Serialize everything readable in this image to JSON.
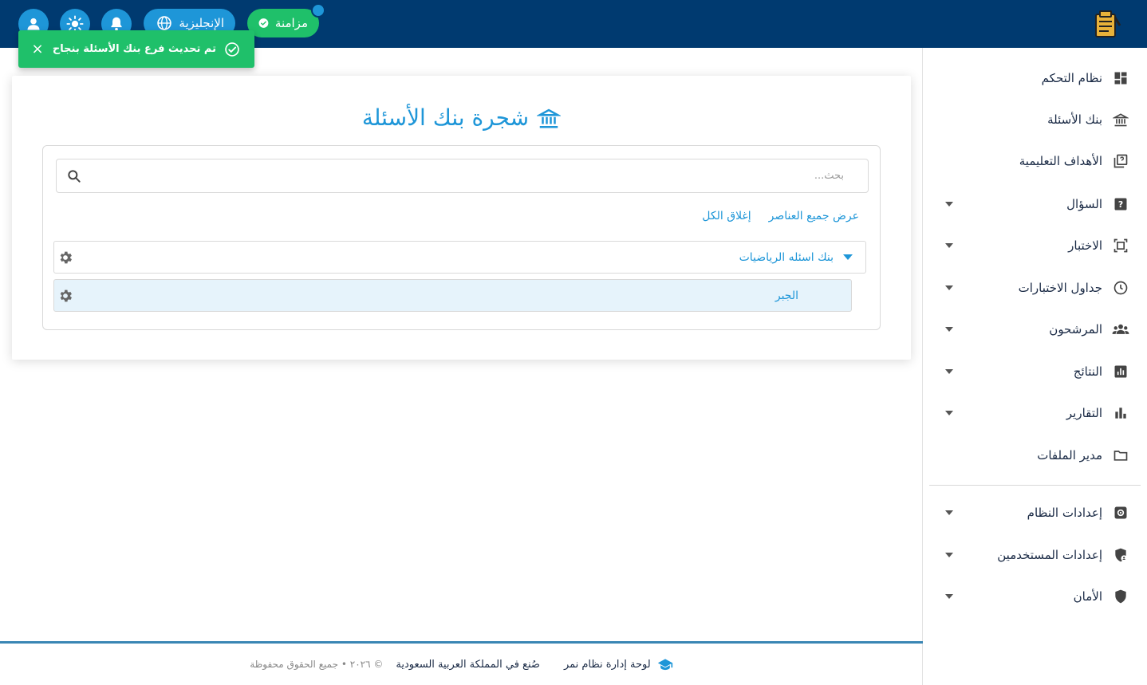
{
  "topbar": {
    "sync_label": "مزامنة",
    "language_label": "الإنجليزية",
    "icons": [
      "user-icon",
      "sun-icon",
      "bell-icon",
      "globe-icon",
      "check-circle-icon"
    ],
    "colors": {
      "bar": "#003a70",
      "accent": "#1e96d8",
      "success": "#1fc06a"
    }
  },
  "toast": {
    "message": "تم تحديث فرع بنك الأسئلة بنجاح",
    "close": "×"
  },
  "sidebar": {
    "items": [
      {
        "label": "نظام التحكم",
        "icon": "dashboard-icon",
        "has_submenu": false
      },
      {
        "label": "بنك الأسئلة",
        "icon": "bank-icon",
        "has_submenu": false
      },
      {
        "label": "الأهداف التعليمية",
        "icon": "quiz-icon",
        "has_submenu": false
      },
      {
        "label": "السؤال",
        "icon": "question-icon",
        "has_submenu": true
      },
      {
        "label": "الاختبار",
        "icon": "exam-icon",
        "has_submenu": true
      },
      {
        "label": "جداول الاختبارات",
        "icon": "clock-icon",
        "has_submenu": true
      },
      {
        "label": "المرشحون",
        "icon": "people-icon",
        "has_submenu": true
      },
      {
        "label": "النتائج",
        "icon": "analytics-icon",
        "has_submenu": true
      },
      {
        "label": "التقارير",
        "icon": "bar-chart-icon",
        "has_submenu": true
      },
      {
        "label": "مدير الملفات",
        "icon": "folder-icon",
        "has_submenu": false
      }
    ],
    "settings_items": [
      {
        "label": "إعدادات النظام",
        "icon": "settings-icon",
        "has_submenu": true
      },
      {
        "label": "إعدادات المستخدمين",
        "icon": "admin-shield-icon",
        "has_submenu": true
      },
      {
        "label": "الأمان",
        "icon": "shield-icon",
        "has_submenu": true
      }
    ]
  },
  "main": {
    "title": "شجرة بنك الأسئلة",
    "search_placeholder": "بحث...",
    "show_all": "عرض جميع العناصر",
    "collapse_all": "إغلاق الكل",
    "tree": {
      "root": "بنك اسئله الرياضيات",
      "children": [
        "الجبر"
      ]
    }
  },
  "footer": {
    "brand": "لوحة إدارة نظام نمر",
    "made_in": "صُنع في المملكة العربية السعودية",
    "copyright": "© ٢٠٢٦ • جميع الحقوق محفوظة"
  }
}
